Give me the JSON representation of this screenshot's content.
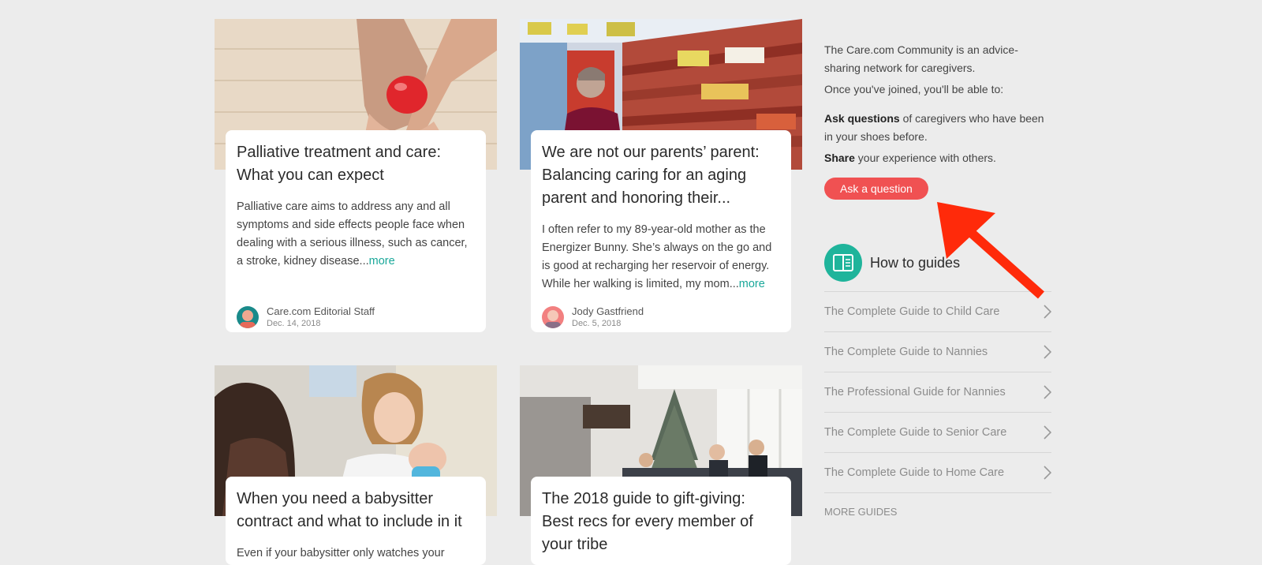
{
  "articles": [
    {
      "title": "Palliative treatment and care: What you can expect",
      "excerpt": "Palliative care aims to address any and all symptoms and side effects people face when dealing with a serious illness, such as cancer, a stroke, kidney disease...",
      "more": "more",
      "author": "Care.com Editorial Staff",
      "date": "Dec. 14, 2018"
    },
    {
      "title": "We are not our parents’ parent: Balancing caring for an aging parent and honoring their...",
      "excerpt": "I often refer to my 89-year-old mother as the Energizer Bunny.  She’s always on the go and is good at recharging her reservoir of energy. While her walking is limited, my mom...",
      "more": "more",
      "author": "Jody Gastfriend",
      "date": "Dec. 5, 2018"
    },
    {
      "title": "When you need a babysitter contract and what to include in it",
      "excerpt": "Even if your babysitter only watches your"
    },
    {
      "title": "The 2018 guide to gift-giving: Best recs for every member of your tribe"
    }
  ],
  "sidebar": {
    "intro1": "The Care.com Community is an advice-sharing network for caregivers.",
    "intro2": "Once you've joined, you'll be able to:",
    "ask_bold": "Ask questions",
    "ask_rest": " of caregivers who have been in your shoes before.",
    "share_bold": "Share",
    "share_rest": " your experience with others.",
    "ask_button": "Ask a question",
    "guides_title": "How to guides",
    "guides": [
      "The Complete Guide to Child Care",
      "The Complete Guide to Nannies",
      "The Professional Guide for Nannies",
      "The Complete Guide to Senior Care",
      "The Complete Guide to Home Care"
    ],
    "more_guides": "MORE GUIDES"
  },
  "colors": {
    "accent_button": "#f05152",
    "link_teal": "#1aa89a",
    "guides_icon_bg": "#1fb49b",
    "annotation_arrow": "#ff2a0a"
  }
}
